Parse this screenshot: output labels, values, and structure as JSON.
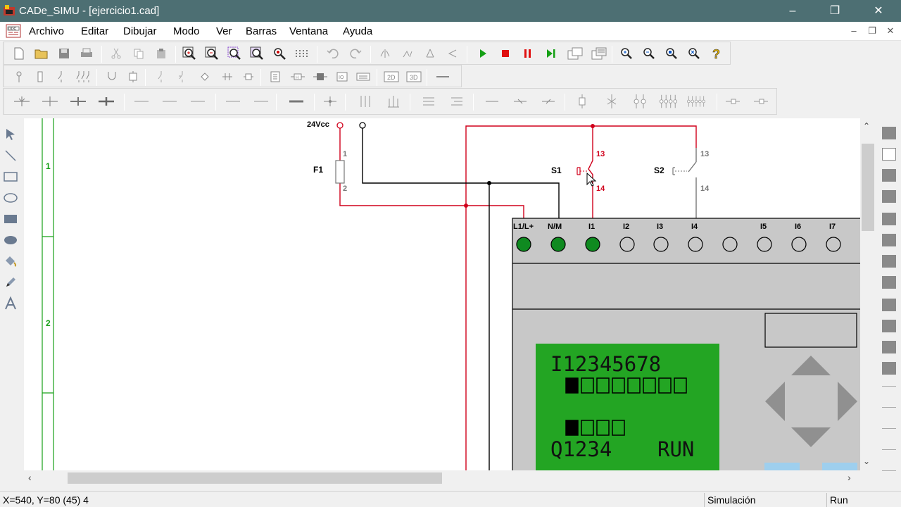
{
  "window": {
    "title": "CADe_SIMU - [ejercicio1.cad]",
    "controls": [
      "minimize",
      "maximize",
      "close"
    ]
  },
  "menu": {
    "items": [
      "Archivo",
      "Editar",
      "Dibujar",
      "Modo",
      "Ver",
      "Barras",
      "Ventana",
      "Ayuda"
    ]
  },
  "toolbar1": {
    "buttons": [
      "new-file-icon",
      "open-folder-icon",
      "save-icon",
      "print-icon",
      "cut-icon",
      "copy-icon",
      "paste-icon",
      "zoom-in-icon",
      "zoom-out-icon",
      "zoom-window-icon",
      "zoom-fit-icon",
      "zoom-all-icon",
      "grid-icon",
      "undo-icon",
      "redo-icon",
      "mirror-icon",
      "mirror-v-icon",
      "rotate-icon",
      "rotate-back-icon"
    ],
    "sim_controls": [
      "play-icon",
      "stop-icon",
      "pause-icon",
      "step-icon"
    ],
    "zoom_controls": [
      "zoom-1-icon",
      "zoom-2-icon",
      "zoom-3-icon",
      "zoom-4-icon",
      "help-icon"
    ]
  },
  "toolbar2": {
    "buttons": [
      "power-supply-icon",
      "fuse-icon",
      "switch-icon",
      "three-phase-icon",
      "motor-icon",
      "contactor-icon",
      "push-button-icon",
      "switch-nc-icon",
      "diode-icon",
      "capacitor-icon",
      "transformer-icon",
      "lamp-icon",
      "coil-icon",
      "timer-icon",
      "counter-icon",
      "plc-icon",
      "2d-icon",
      "3d-icon",
      "wire-icon"
    ],
    "text_2d": "2D",
    "text_3d": "3D",
    "text_io": "IO"
  },
  "toolbar3": {
    "buttons": [
      "contact-no-icon",
      "contact-nc-icon",
      "contact-no2-icon",
      "contact-nc2-icon",
      "line-1-icon",
      "line-2-icon",
      "line-3-icon",
      "line-4-icon",
      "line-5-icon",
      "line-thick-icon",
      "cross-icon",
      "bus-3-icon",
      "bus-3b-icon",
      "bus-h-icon",
      "bus-h2-icon",
      "wire-h-icon",
      "wire-h2-icon",
      "wire-h3-icon",
      "terminal-icon",
      "terminal-2-icon",
      "terminal-3-icon",
      "terminal-4-icon",
      "terminal-5-icon",
      "end-1-icon",
      "end-2-icon"
    ]
  },
  "left_tools": [
    "select-arrow-icon",
    "line-icon",
    "rectangle-icon",
    "ellipse-icon",
    "filled-rect-icon",
    "filled-ellipse-icon",
    "fill-bucket-icon",
    "pen-icon",
    "text-tool-icon"
  ],
  "right_tools": [
    "panel-1-icon",
    "panel-2-icon",
    "panel-3-icon",
    "panel-4-icon",
    "panel-5-icon",
    "panel-6-icon",
    "panel-7-icon",
    "panel-8-icon",
    "panel-9-icon",
    "panel-10-icon",
    "panel-11-icon",
    "panel-12-icon",
    "panel-13-icon",
    "panel-14-icon",
    "panel-15-icon"
  ],
  "schematic": {
    "row_labels": [
      "1",
      "2"
    ],
    "supply_label": "24Vcc",
    "fuse": {
      "name": "F1",
      "pin_top": "1",
      "pin_bottom": "2"
    },
    "s1": {
      "name": "S1",
      "pin_top": "13",
      "pin_bottom": "14"
    },
    "s2": {
      "name": "S2",
      "pin_top": "13",
      "pin_bottom": "14"
    },
    "colors": {
      "energized": "#d0001b",
      "neutral": "#000000",
      "row_line": "#18a018",
      "led_on": "#0f8a20"
    }
  },
  "plc": {
    "terminals": [
      "L1/L+",
      "N/M",
      "I1",
      "I2",
      "I3",
      "I4",
      "I5",
      "I6",
      "I7"
    ],
    "terminal_states": [
      true,
      true,
      true,
      false,
      false,
      false,
      false,
      false,
      false
    ],
    "lcd_line1": "I12345678",
    "lcd_line2_states": [
      true,
      false,
      false,
      false,
      false,
      false,
      false,
      false
    ],
    "lcd_line3_states": [
      true,
      false,
      false,
      false
    ],
    "lcd_line4_left": "Q1234",
    "lcd_line4_right": "RUN",
    "lcd_color": "#23a523"
  },
  "statusbar": {
    "coords": "X=540, Y=80 (45) 4",
    "mode": "Simulación",
    "state": "Run"
  }
}
